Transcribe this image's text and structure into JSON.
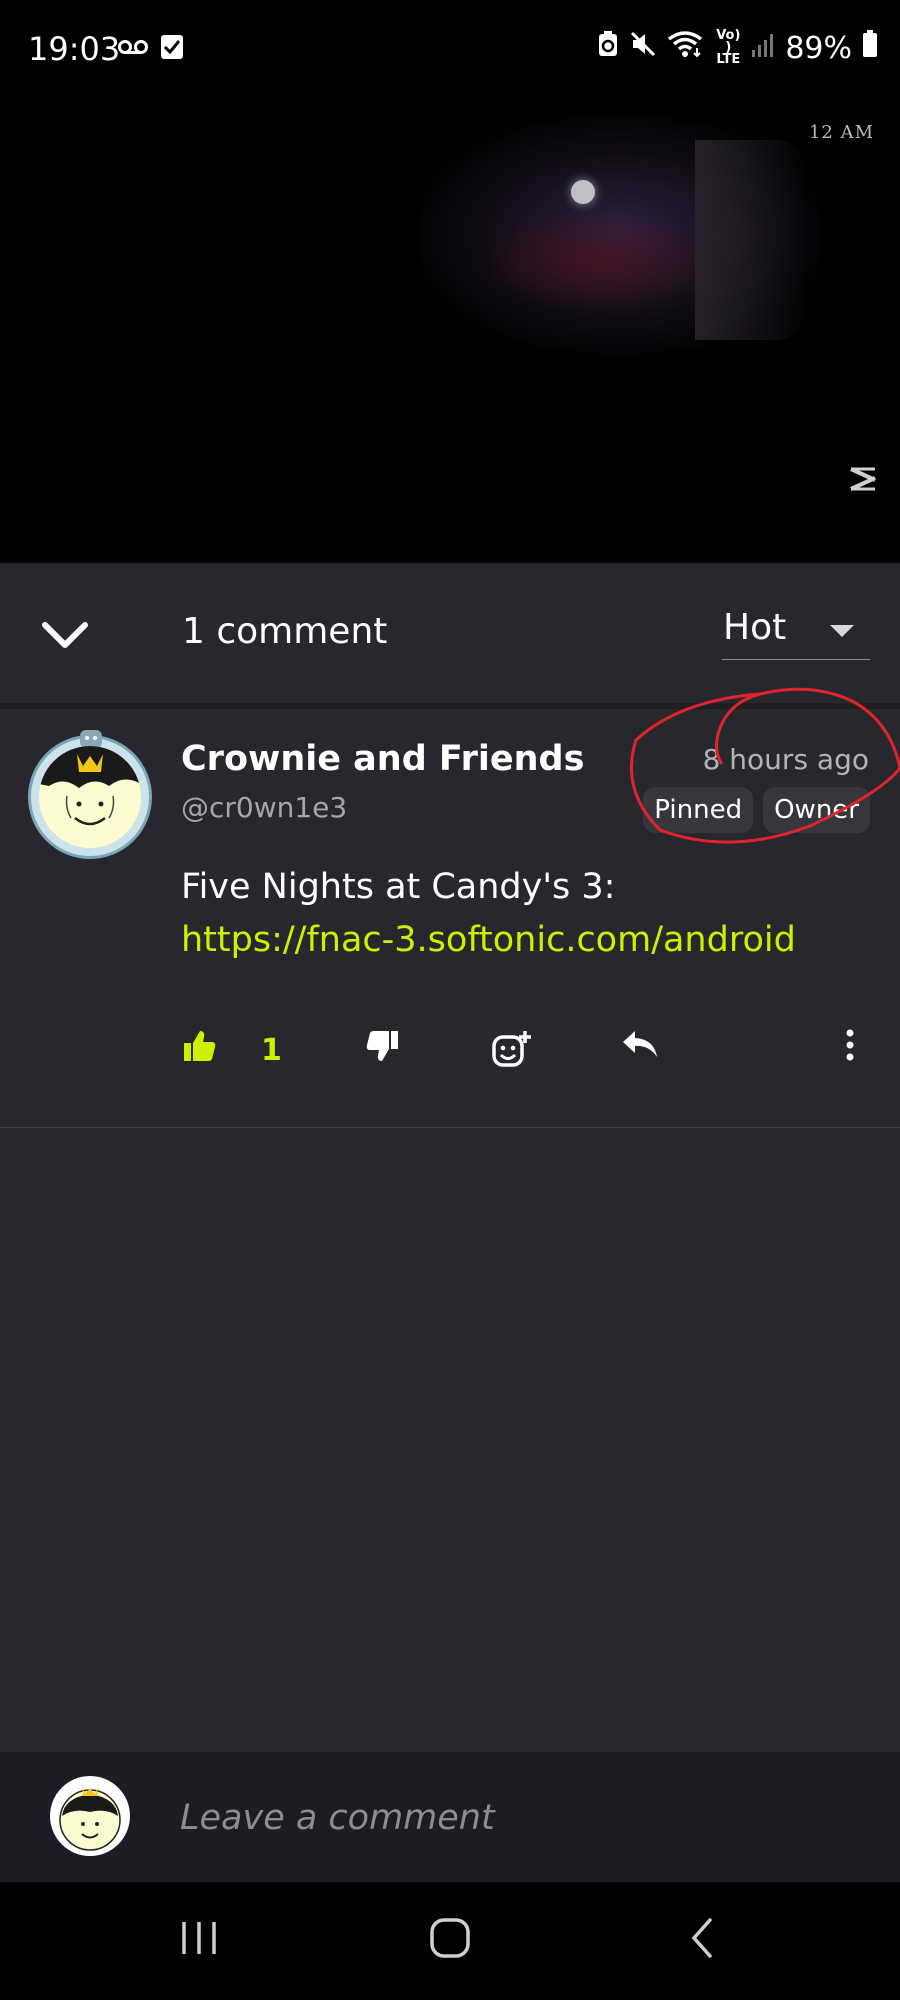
{
  "status_bar": {
    "time": "19:03",
    "left_icons": [
      "voicemail-icon",
      "check-box-icon"
    ],
    "right_icons": [
      "data-saver-icon",
      "mute-icon",
      "wifi-icon",
      "volte-icon",
      "signal-icon",
      "battery-icon"
    ],
    "volte_label": "Vo)) LTE",
    "battery": "89%"
  },
  "video": {
    "overlay_time": "12 AM",
    "watermark_icon": "capcut-icon"
  },
  "comments": {
    "count_label": "1 comment",
    "sort": {
      "selected": "Hot"
    },
    "items": [
      {
        "author": "Crownie and Friends",
        "handle": "@cr0wn1e3",
        "time": "8 hours ago",
        "badges": [
          "Pinned",
          "Owner"
        ],
        "text": "Five Nights at Candy's 3: ",
        "link": "https://fnac-3.softonic.com/android",
        "likes": "1"
      }
    ]
  },
  "composer": {
    "placeholder": "Leave a comment"
  },
  "colors": {
    "accent": "#cdf000",
    "panel_bg": "#28272d",
    "annotation_red": "#e0242b"
  }
}
